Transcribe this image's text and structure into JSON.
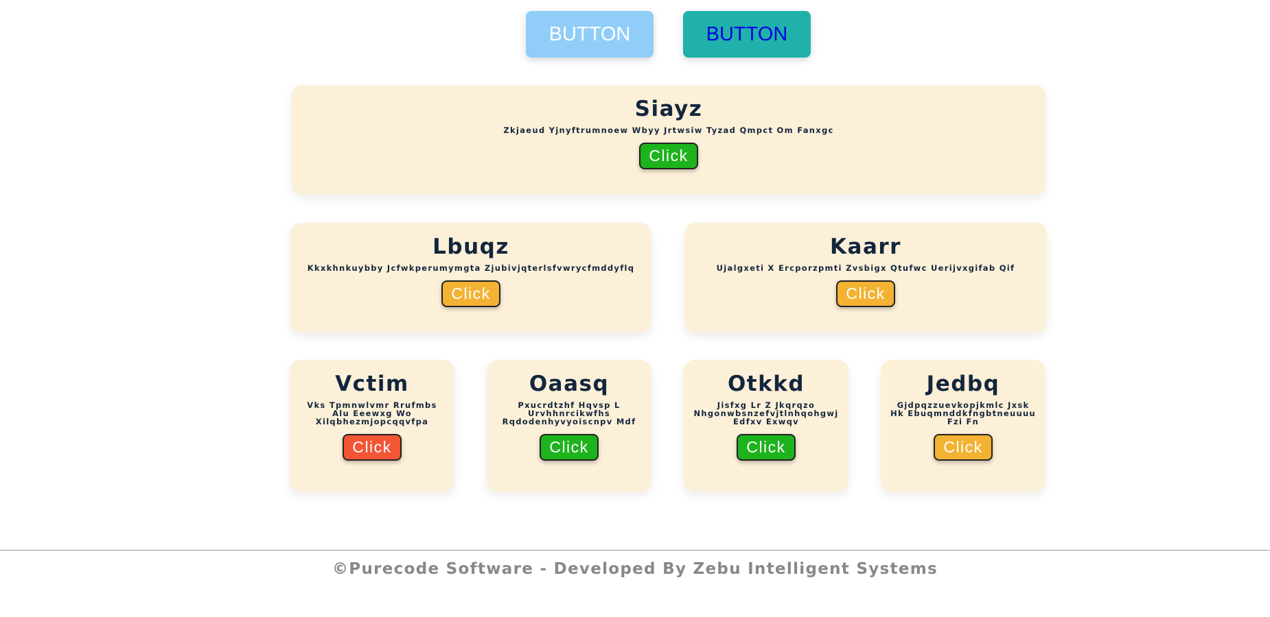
{
  "top_buttons": [
    {
      "label": "BUTTON",
      "bg": "#90cdf9",
      "color": "#ffffff"
    },
    {
      "label": "BUTTON",
      "bg": "#20b2aa",
      "color": "#0000e0"
    }
  ],
  "cards": [
    {
      "title": "Siayz",
      "desc": "Zkjaeud Yjnyftrumnoew Wbyy Jrtwsiw Tyzad Qmpct Om Fanxgc",
      "button": "Click",
      "button_color": "#1db31d"
    },
    {
      "title": "Lbuqz",
      "desc": "Kkxkhnkuybby Jcfwkperumymgta Zjubivjqterlsfvwrycfmddyflq",
      "button": "Click",
      "button_color": "#f3b232"
    },
    {
      "title": "Kaarr",
      "desc": "Ujalgxeti X Ercporzpmti Zvsbigx Qtufwc Uerijvxgifab Qif",
      "button": "Click",
      "button_color": "#f3b232"
    },
    {
      "title": "Vctim",
      "desc": "Vks Tpmnwlvmr Rrufmbs Alu Eeewxg Wo Xilqbhezmjopcqqvfpa",
      "button": "Click",
      "button_color": "#f35535"
    },
    {
      "title": "Oaasq",
      "desc": "Pxucrdtzhf Hqvsp L Urvhhnrcikwfhs Rqdodenhyvyoiscnpv Mdf",
      "button": "Click",
      "button_color": "#1db31d"
    },
    {
      "title": "Otkkd",
      "desc": "Jisfxg Lr Z Jkqrqzo Nhgonwbsnzefvjtlnhqohgwj Edfxv Exwqv",
      "button": "Click",
      "button_color": "#1db31d"
    },
    {
      "title": "Jedbq",
      "desc": "Gjdpqzzuevkopjkmlc Jxsk Hk Ebuqmnddkfngbtneuuuu Fzi Fn",
      "button": "Click",
      "button_color": "#f3b232"
    }
  ],
  "footer": {
    "text": "©Purecode Software - Developed By Zebu Intelligent Systems"
  }
}
